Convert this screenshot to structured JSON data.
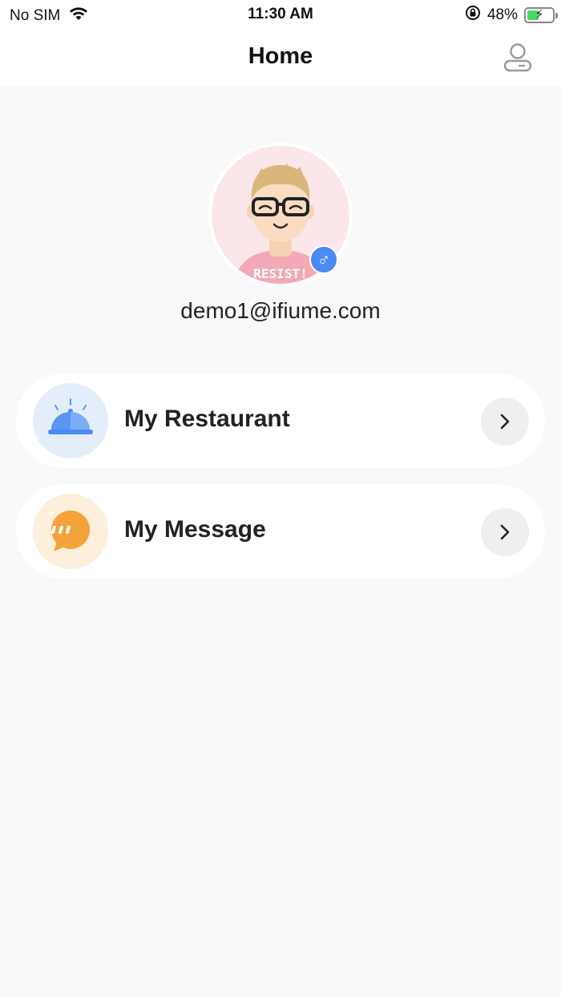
{
  "status_bar": {
    "carrier": "No SIM",
    "time": "11:30 AM",
    "battery_percent": "48%",
    "battery_level": 0.48,
    "icons": [
      "wifi-icon",
      "rotation-lock-icon",
      "battery-charging-icon"
    ]
  },
  "nav": {
    "title": "Home",
    "profile_icon": "user-icon"
  },
  "profile": {
    "avatar_shirt_text": "RESIST!",
    "gender_symbol": "♂",
    "email": "demo1@ifiume.com"
  },
  "menu": [
    {
      "label": "My Restaurant",
      "icon": "food-cloche-icon",
      "accent": "#4a8af4"
    },
    {
      "label": "My Message",
      "icon": "chat-bubble-icon",
      "accent": "#f3a33a"
    }
  ],
  "colors": {
    "background": "#f9f9f9",
    "card": "#ffffff",
    "blue_accent": "#4a8af4",
    "orange_accent": "#f3a33a"
  }
}
